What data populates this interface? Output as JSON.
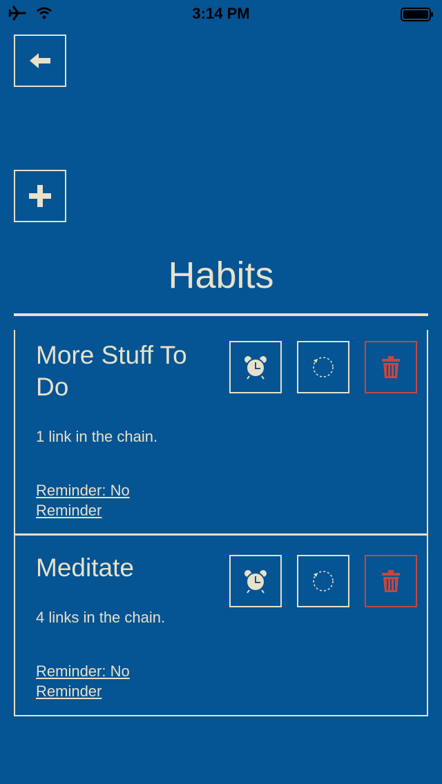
{
  "status_bar": {
    "time": "3:14 PM"
  },
  "page": {
    "title": "Habits"
  },
  "colors": {
    "background": "#055494",
    "foreground": "#e9e1c8",
    "danger": "#c8463c"
  },
  "icons": {
    "back": "arrow-left-icon",
    "add": "plus-icon",
    "reminder": "alarm-clock-icon",
    "reset": "reset-icon",
    "delete": "trash-icon"
  },
  "habits": [
    {
      "name": "More Stuff To Do",
      "count": "1 link in the chain.",
      "reminder": "Reminder: No Reminder"
    },
    {
      "name": "Meditate",
      "count": "4 links in the chain.",
      "reminder": "Reminder: No Reminder"
    }
  ]
}
